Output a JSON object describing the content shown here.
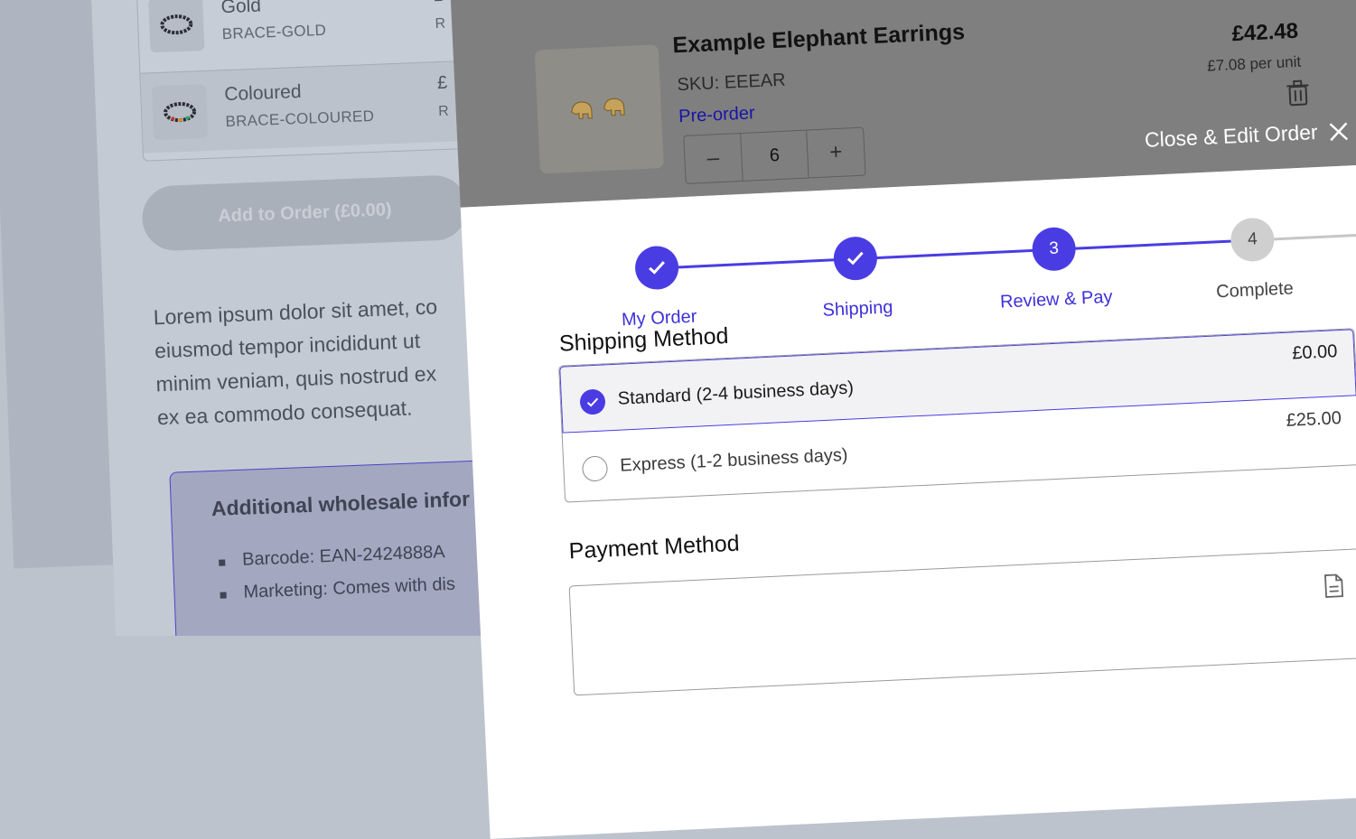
{
  "background": {
    "variants": [
      {
        "name": "Gold",
        "sku": "BRACE-GOLD",
        "price": "£",
        "code": "R"
      },
      {
        "name": "Coloured",
        "sku": "BRACE-COLOURED",
        "price": "£",
        "code": "R"
      }
    ],
    "add_button": "Add to Order (£0.00)",
    "description": [
      "Lorem ipsum dolor sit amet, co",
      "eiusmod tempor incididunt ut",
      "minim veniam, quis nostrud ex",
      "ex ea commodo consequat."
    ],
    "info": {
      "title": "Additional wholesale infor",
      "items": [
        "Barcode: EAN-2424888A",
        "Marketing: Comes with dis"
      ]
    }
  },
  "modal": {
    "cart_item": {
      "name": "Example Elephant Earrings",
      "sku": "SKU: EEEAR",
      "status": "Pre-order",
      "quantity": "6",
      "decrement": "–",
      "increment": "+",
      "price": "£42.48",
      "unit_price": "£7.08 per unit"
    },
    "close_label": "Close & Edit Order",
    "steps": [
      {
        "label": "My Order",
        "marker": "",
        "state": "done"
      },
      {
        "label": "Shipping",
        "marker": "",
        "state": "done"
      },
      {
        "label": "Review & Pay",
        "marker": "3",
        "state": "active"
      },
      {
        "label": "Complete",
        "marker": "4",
        "state": "todo"
      }
    ],
    "shipping": {
      "title": "Shipping Method",
      "options": [
        {
          "label": "Standard (2-4 business days)",
          "price": "£0.00",
          "selected": true
        },
        {
          "label": "Express (1-2 business days)",
          "price": "£25.00",
          "selected": false
        }
      ]
    },
    "payment": {
      "title": "Payment Method"
    }
  },
  "colors": {
    "accent": "#4a3ce3",
    "overlay": "#7f7f7f",
    "link": "#1a14a8"
  }
}
